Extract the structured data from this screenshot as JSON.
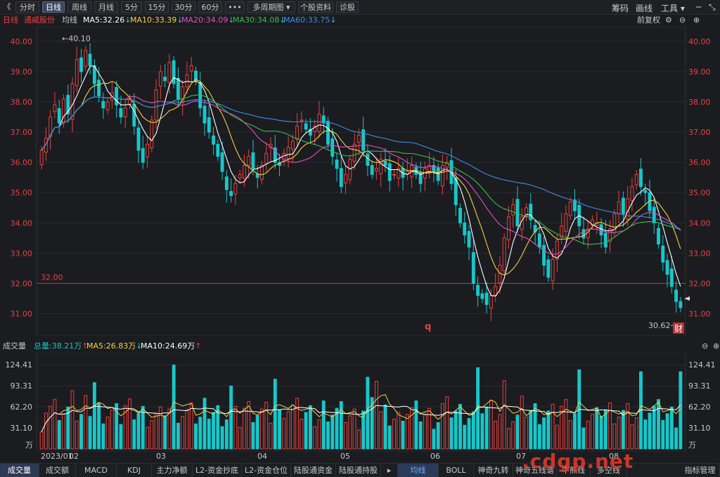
{
  "toolbar": {
    "back": "《",
    "buttons": [
      "分时",
      "日线",
      "周线",
      "月线",
      "5分",
      "15分",
      "30分",
      "60分",
      "•••",
      "多周期图 ▾",
      "个股资料",
      "诊股"
    ],
    "active_index": 1,
    "right_items": [
      "筹码",
      "画线",
      "工具 ▾"
    ],
    "window_controls": [
      "─",
      "⤡"
    ]
  },
  "ma_bar": {
    "period": "日线",
    "stock_name": "通威股份",
    "avg_label": "均线",
    "ma5": "MA5:32.26",
    "ma10": "MA10:33.39",
    "ma20": "MA20:34.09",
    "ma30": "MA30:34.08",
    "ma60": "MA60:33.75",
    "right_label": "前复权",
    "right_icons": [
      "⚙",
      "⊖",
      "⊕"
    ]
  },
  "colors": {
    "up": "#e8413e",
    "down": "#17c7c9",
    "ma5": "#ffffff",
    "ma10": "#f5d142",
    "ma20": "#e44ec6",
    "ma30": "#35c04b",
    "ma60": "#3a8ee8",
    "axis_text": "#e8413e"
  },
  "price_axis": {
    "ticks": [
      "40.00",
      "39.00",
      "38.00",
      "37.00",
      "36.00",
      "35.00",
      "34.00",
      "33.00",
      "32.00",
      "31.00"
    ],
    "high_label": "←40.10",
    "low_label": "30.62→",
    "ref_line_label": "32.00",
    "marker_q": "q",
    "marker_cai": "财"
  },
  "volume_head": {
    "title": "成交量",
    "total": "总量:38.21万",
    "ma5": "MA5:26.83万",
    "ma10": "MA10:24.69万",
    "icons": [
      "⊖",
      "⊕"
    ]
  },
  "volume_axis": {
    "ticks": [
      "124.41",
      "93.31",
      "62.20",
      "31.10",
      "万"
    ]
  },
  "date_axis": {
    "labels": [
      "2023/01",
      "02",
      "03",
      "04",
      "05",
      "06",
      "07",
      "08"
    ]
  },
  "chart_data": {
    "type": "candlestick",
    "title": "通威股份 日线",
    "ylim": [
      30.5,
      40.3
    ],
    "reference_line": 32.0,
    "max_price": 40.1,
    "min_price": 30.62,
    "latest_ma": {
      "MA5": 32.26,
      "MA10": 33.39,
      "MA20": 34.09,
      "MA30": 34.08,
      "MA60": 33.75
    },
    "closes": [
      36.4,
      36.8,
      37.5,
      37.9,
      37.3,
      38.1,
      37.6,
      38.6,
      39.4,
      39.0,
      39.7,
      39.2,
      38.6,
      38.2,
      37.8,
      38.0,
      38.3,
      37.9,
      37.5,
      37.8,
      38.1,
      37.2,
      36.4,
      36.0,
      36.6,
      37.4,
      38.4,
      39.0,
      38.7,
      39.3,
      38.6,
      38.1,
      38.5,
      38.9,
      39.2,
      38.7,
      37.8,
      37.3,
      37.0,
      36.6,
      36.2,
      35.7,
      35.1,
      34.9,
      35.3,
      35.6,
      35.9,
      36.2,
      35.8,
      35.5,
      35.9,
      36.3,
      36.6,
      36.0,
      35.9,
      36.3,
      36.5,
      36.7,
      37.2,
      37.4,
      37.1,
      36.9,
      37.2,
      37.6,
      37.3,
      36.6,
      36.2,
      35.8,
      35.2,
      35.6,
      36.1,
      36.6,
      36.9,
      36.4,
      35.9,
      35.6,
      35.8,
      36.1,
      35.9,
      35.4,
      35.6,
      35.8,
      35.5,
      35.7,
      35.9,
      35.6,
      35.3,
      35.8,
      35.9,
      35.7,
      35.4,
      35.9,
      36.0,
      35.3,
      34.6,
      34.0,
      33.6,
      33.2,
      32.0,
      31.6,
      31.5,
      31.3,
      31.6,
      31.9,
      32.6,
      33.5,
      34.2,
      34.6,
      33.9,
      34.2,
      34.5,
      34.1,
      33.7,
      33.2,
      32.6,
      32.2,
      32.8,
      33.4,
      33.9,
      34.3,
      34.7,
      34.4,
      33.9,
      33.5,
      33.8,
      34.1,
      34.0,
      33.6,
      33.2,
      33.8,
      34.3,
      34.7,
      34.3,
      34.8,
      35.2,
      35.6,
      35.2,
      35.0,
      34.4,
      34.0,
      33.3,
      32.7,
      32.3,
      31.9,
      31.4,
      31.2
    ],
    "volume_ylim": [
      0,
      135
    ],
    "volume_unit": "万"
  }
}
